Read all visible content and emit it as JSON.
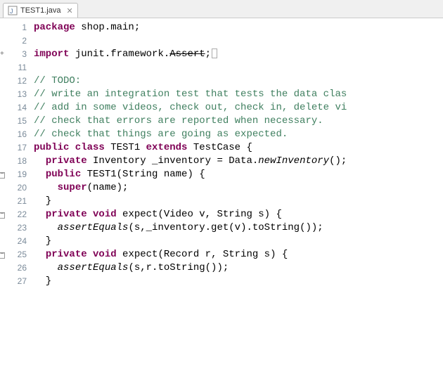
{
  "tab": {
    "filename": "TEST1.java",
    "close_glyph": "✕"
  },
  "lines": [
    {
      "n": 1,
      "marker": "",
      "t": [
        [
          "k",
          "package"
        ],
        [
          "",
          " shop.main;"
        ]
      ]
    },
    {
      "n": 2,
      "marker": "",
      "t": []
    },
    {
      "n": 3,
      "marker": "warn-exp",
      "t": [
        [
          "k",
          "import"
        ],
        [
          "",
          " junit.framework."
        ],
        [
          "strike",
          "Assert"
        ],
        [
          "",
          ";"
        ],
        [
          "box",
          ""
        ]
      ]
    },
    {
      "n": 11,
      "marker": "",
      "t": []
    },
    {
      "n": 12,
      "marker": "info",
      "t": [
        [
          "c",
          "// TODO:"
        ]
      ]
    },
    {
      "n": 13,
      "marker": "",
      "t": [
        [
          "c",
          "// write an integration test that tests the data clas"
        ]
      ]
    },
    {
      "n": 14,
      "marker": "",
      "t": [
        [
          "c",
          "// add in some videos, check out, check in, delete vi"
        ]
      ]
    },
    {
      "n": 15,
      "marker": "",
      "t": [
        [
          "c",
          "// check that errors are reported when necessary."
        ]
      ]
    },
    {
      "n": 16,
      "marker": "",
      "t": [
        [
          "c",
          "// check that things are going as expected."
        ]
      ]
    },
    {
      "n": 17,
      "marker": "",
      "t": [
        [
          "k",
          "public class"
        ],
        [
          "",
          " TEST1 "
        ],
        [
          "k",
          "extends"
        ],
        [
          "",
          " TestCase {"
        ]
      ]
    },
    {
      "n": 18,
      "marker": "",
      "t": [
        [
          "",
          "  "
        ],
        [
          "k",
          "private"
        ],
        [
          "",
          " Inventory _inventory = Data."
        ],
        [
          "it",
          "newInventory"
        ],
        [
          "",
          "();"
        ]
      ]
    },
    {
      "n": 19,
      "marker": "col",
      "t": [
        [
          "",
          "  "
        ],
        [
          "k",
          "public"
        ],
        [
          "",
          " TEST1(String name) {"
        ]
      ]
    },
    {
      "n": 20,
      "marker": "",
      "t": [
        [
          "",
          "    "
        ],
        [
          "k",
          "super"
        ],
        [
          "",
          "(name);"
        ]
      ]
    },
    {
      "n": 21,
      "marker": "",
      "t": [
        [
          "",
          "  }"
        ]
      ]
    },
    {
      "n": 22,
      "marker": "col",
      "t": [
        [
          "",
          "  "
        ],
        [
          "k",
          "private void"
        ],
        [
          "",
          " expect(Video v, String s) {"
        ]
      ]
    },
    {
      "n": 23,
      "marker": "",
      "t": [
        [
          "",
          "    "
        ],
        [
          "it",
          "assertEquals"
        ],
        [
          "",
          "(s,_inventory.get(v).toString());"
        ]
      ]
    },
    {
      "n": 24,
      "marker": "",
      "t": [
        [
          "",
          "  }"
        ]
      ]
    },
    {
      "n": 25,
      "marker": "col",
      "t": [
        [
          "",
          "  "
        ],
        [
          "k",
          "private void"
        ],
        [
          "",
          " expect(Record r, String s) {"
        ]
      ]
    },
    {
      "n": 26,
      "marker": "",
      "t": [
        [
          "",
          "    "
        ],
        [
          "it",
          "assertEquals"
        ],
        [
          "",
          "(s,r.toString());"
        ]
      ]
    },
    {
      "n": 27,
      "marker": "",
      "t": [
        [
          "",
          "  }"
        ]
      ]
    }
  ]
}
